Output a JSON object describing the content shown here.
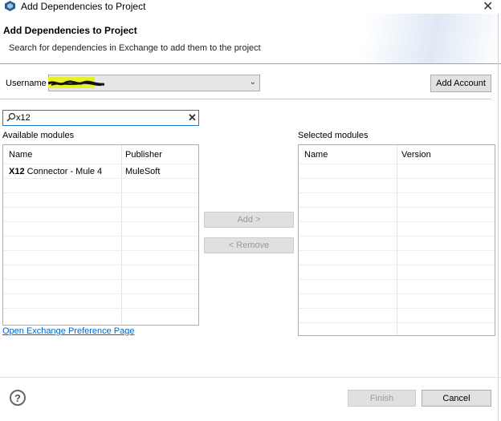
{
  "window": {
    "title": "Add Dependencies to Project",
    "icon": "anypoint-studio-icon",
    "close_icon": "close-icon"
  },
  "banner": {
    "title": "Add Dependencies to Project",
    "description": "Search for dependencies in Exchange to add them to the project"
  },
  "account": {
    "username_label": "Username",
    "add_account_label": "Add Account"
  },
  "search": {
    "value": "x12",
    "icon": "search-icon",
    "clear_icon": "clear-icon"
  },
  "available": {
    "label": "Available modules",
    "columns": [
      "Name",
      "Publisher"
    ],
    "rows": [
      {
        "name_bold": "X12",
        "name_rest": " Connector - Mule 4",
        "publisher": "MuleSoft"
      }
    ]
  },
  "selected": {
    "label": "Selected modules",
    "columns": [
      "Name",
      "Version"
    ],
    "rows": []
  },
  "actions": {
    "add_label": "Add >",
    "remove_label": "< Remove"
  },
  "link": {
    "label": "Open Exchange Preference Page"
  },
  "footer": {
    "help_icon": "help-icon",
    "finish_label": "Finish",
    "cancel_label": "Cancel"
  },
  "colors": {
    "link": "#0066cc",
    "focus_border": "#1f7ad1",
    "highlight": "#e8f02a"
  }
}
